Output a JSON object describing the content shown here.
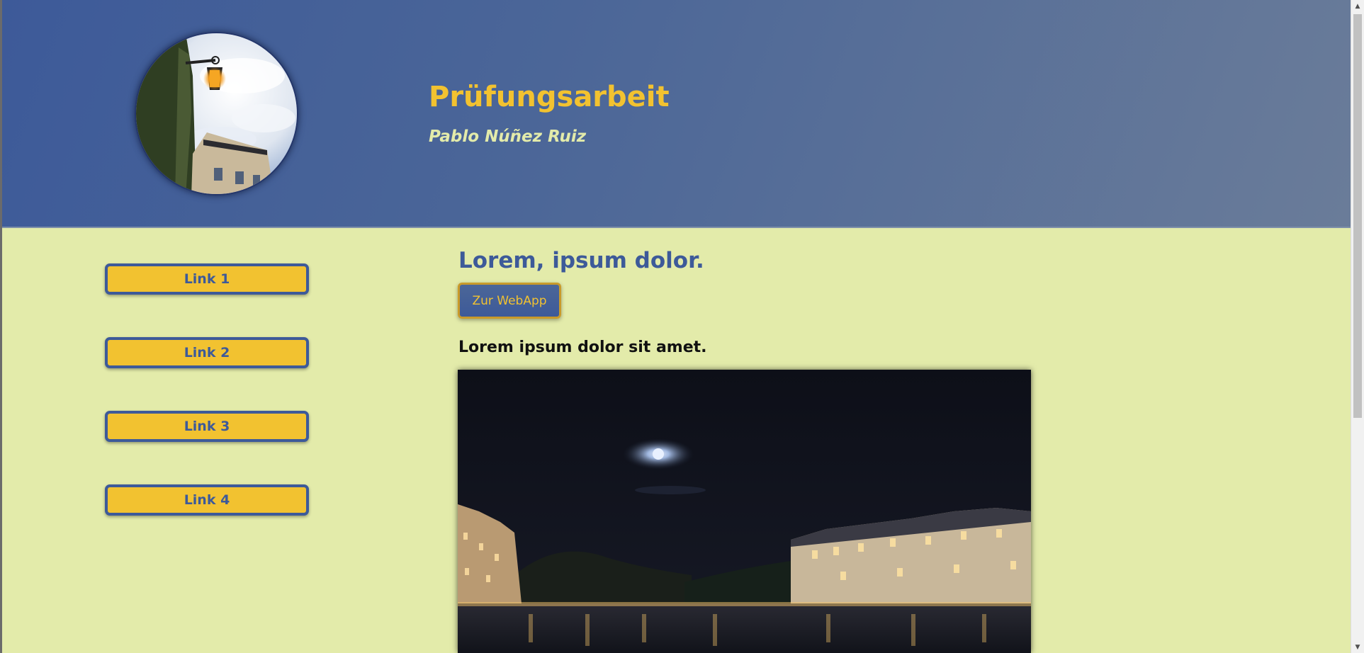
{
  "header": {
    "title": "Prüfungsarbeit",
    "subtitle": "Pablo Núñez Ruiz",
    "logo_icon": "street-lamp-photo"
  },
  "nav": {
    "links": [
      "Link 1",
      "Link 2",
      "Link 3",
      "Link 4"
    ]
  },
  "main": {
    "heading": "Lorem, ipsum dolor.",
    "button_label": "Zur WebApp",
    "subheading": "Lorem ipsum dolor sit amet.",
    "photo_icon": "night-river-city-photo"
  },
  "scrollbar": {
    "up_icon": "▲",
    "down_icon": "▼"
  },
  "colors": {
    "header_blue": "#3d5a99",
    "accent_yellow": "#f2c230",
    "page_background": "#e3ebaa"
  }
}
